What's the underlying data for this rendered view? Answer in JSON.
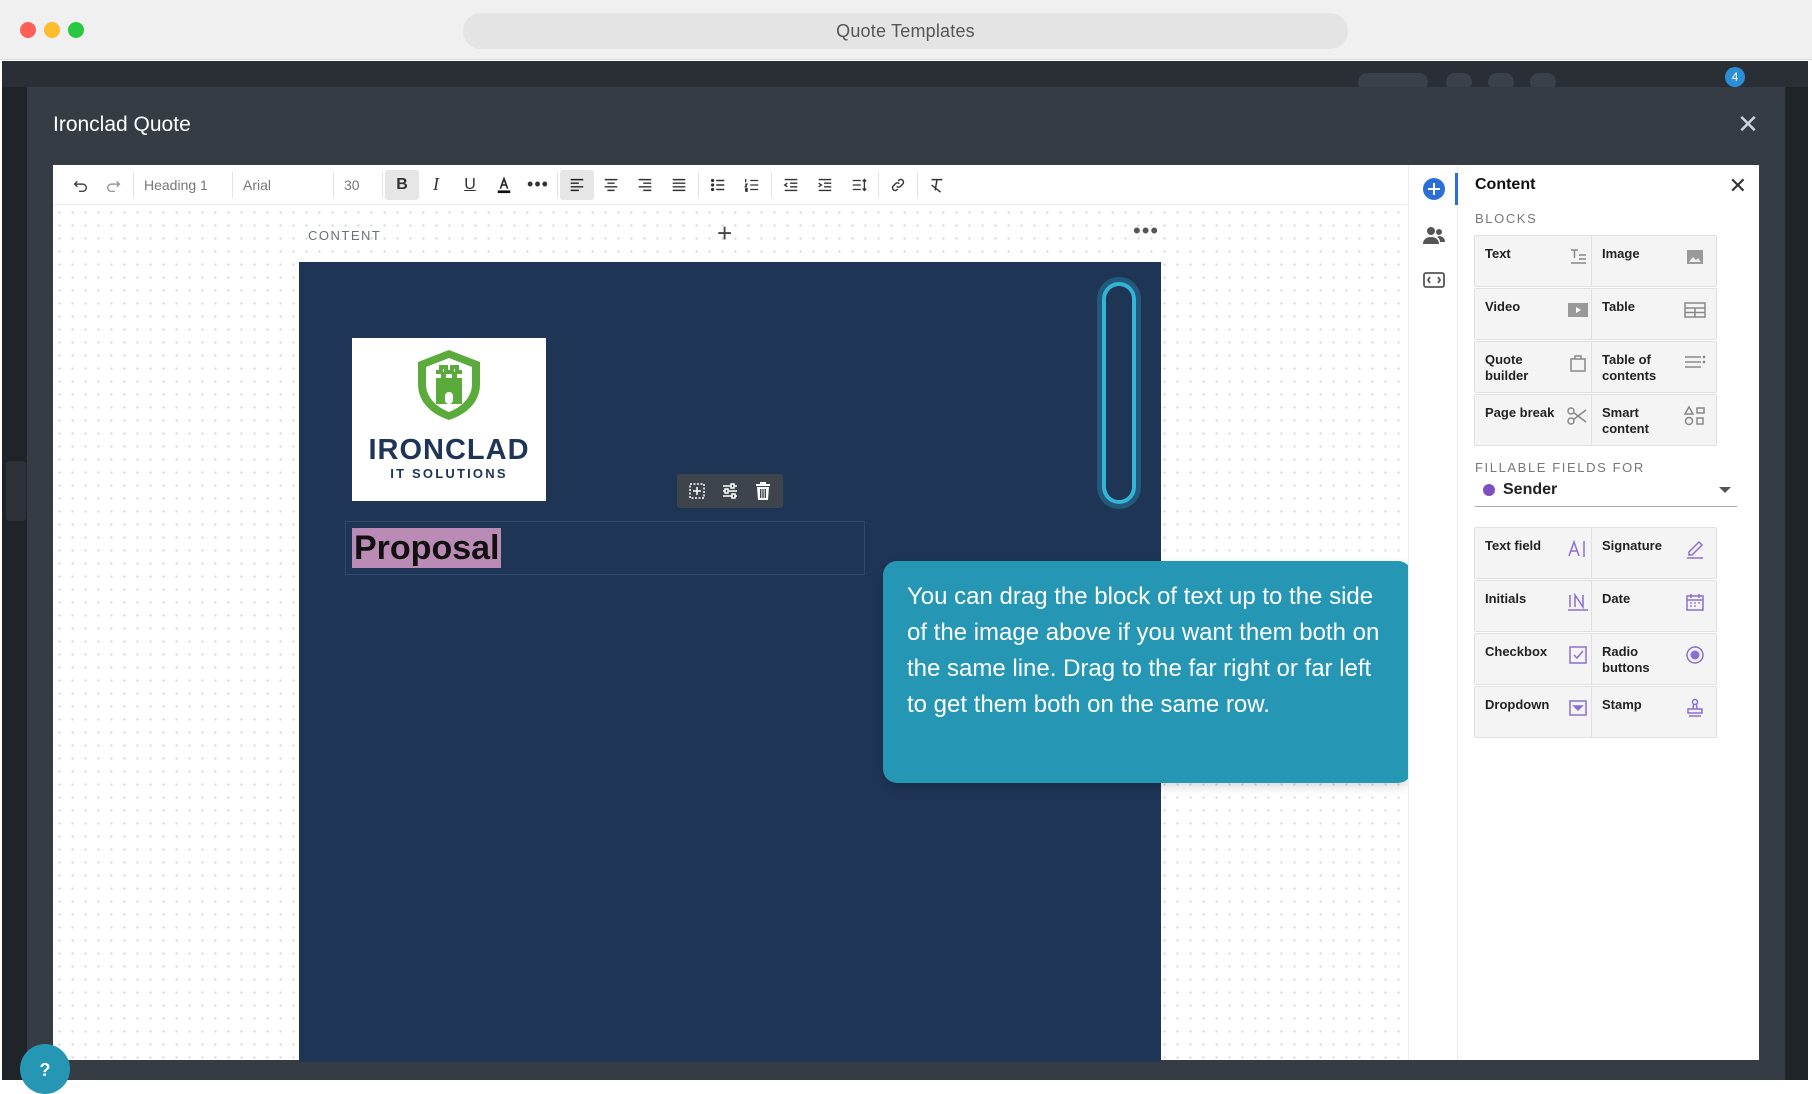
{
  "window": {
    "title": "Quote Templates"
  },
  "app_bg": {
    "badge": "4"
  },
  "modal": {
    "title": "Ironclad Quote"
  },
  "toolbar": {
    "style": "Heading 1",
    "font": "Arial",
    "size": "30"
  },
  "canvas": {
    "content_label": "CONTENT"
  },
  "document": {
    "logo_main": "IRONCLAD",
    "logo_sub": "IT SOLUTIONS",
    "heading": "Proposal"
  },
  "tooltip": {
    "text": "You can drag the block of text up to the side of the image above if you want them both on the same line. Drag to the far right or far left to get them both on the same row."
  },
  "panel": {
    "title": "Content",
    "blocks_label": "BLOCKS",
    "blocks": [
      {
        "label": "Text",
        "icon": "text-block-icon"
      },
      {
        "label": "Image",
        "icon": "image-icon"
      },
      {
        "label": "Video",
        "icon": "video-icon"
      },
      {
        "label": "Table",
        "icon": "table-icon"
      },
      {
        "label": "Quote builder",
        "icon": "bag-icon"
      },
      {
        "label": "Table of contents",
        "icon": "list-icon"
      },
      {
        "label": "Page break",
        "icon": "scissors-icon"
      },
      {
        "label": "Smart content",
        "icon": "shapes-icon"
      }
    ],
    "fields_label": "FILLABLE FIELDS FOR",
    "sender": "Sender",
    "fields": [
      {
        "label": "Text field",
        "icon": "text-field-icon"
      },
      {
        "label": "Signature",
        "icon": "pen-icon"
      },
      {
        "label": "Initials",
        "icon": "initials-icon"
      },
      {
        "label": "Date",
        "icon": "calendar-icon"
      },
      {
        "label": "Checkbox",
        "icon": "checkbox-icon"
      },
      {
        "label": "Radio buttons",
        "icon": "radio-icon"
      },
      {
        "label": "Dropdown",
        "icon": "dropdown-icon"
      },
      {
        "label": "Stamp",
        "icon": "stamp-icon"
      }
    ]
  },
  "colors": {
    "accent": "#2597b4",
    "page": "#1e3556",
    "purple_field": "#8b6fd6"
  },
  "help": {
    "label": "?"
  }
}
